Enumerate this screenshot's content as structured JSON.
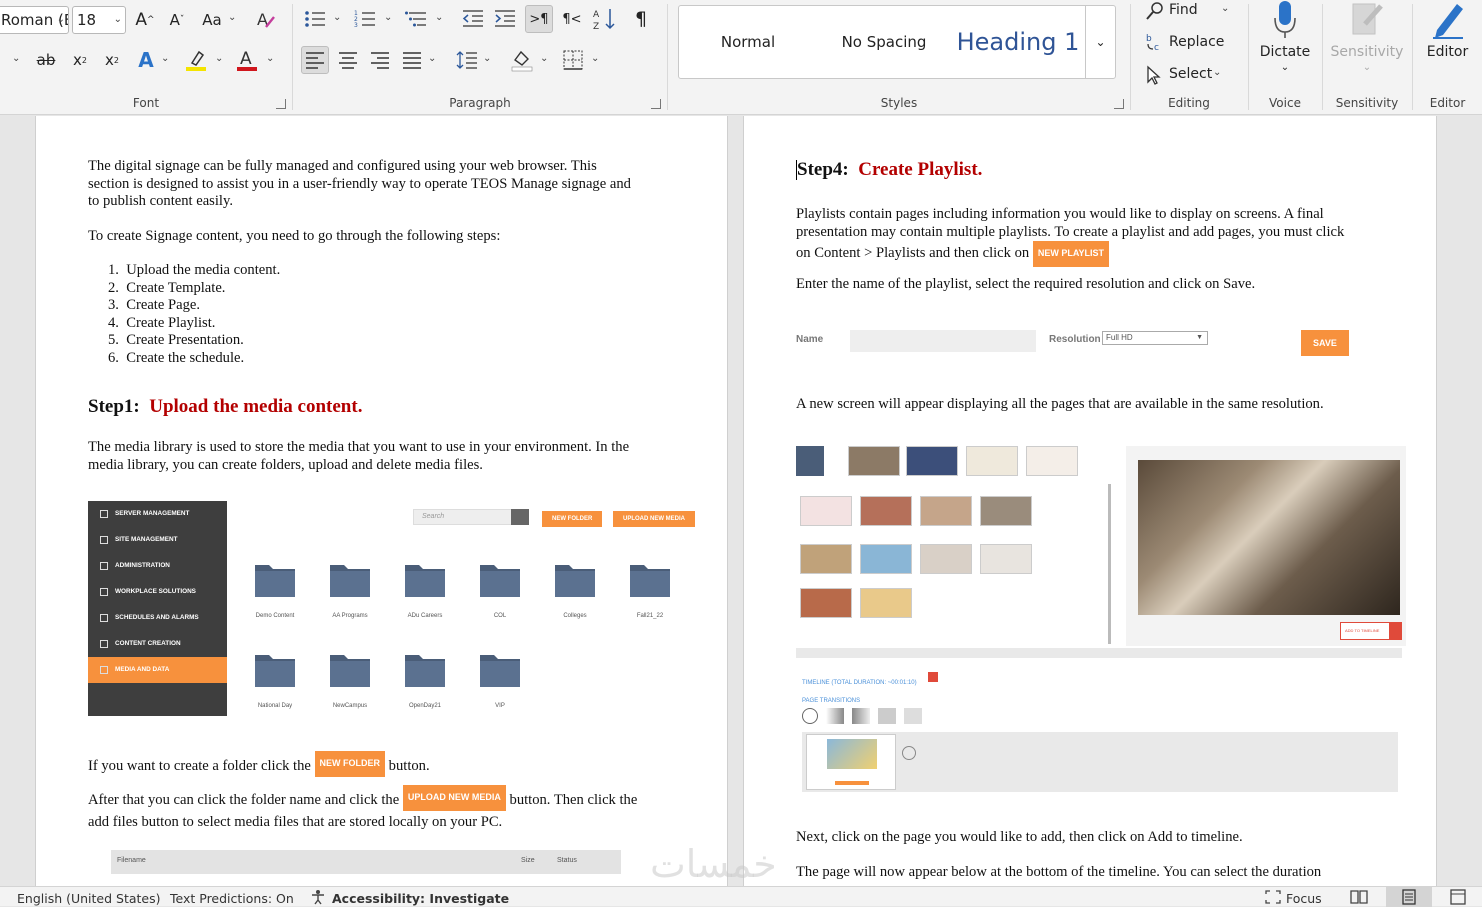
{
  "ribbon": {
    "font_group": {
      "font_name": "Roman (B",
      "font_size": "18",
      "label": "Font",
      "change_case": "Aa"
    },
    "paragraph_group": {
      "label": "Paragraph"
    },
    "styles_group": {
      "label": "Styles",
      "styles": [
        "Normal",
        "No Spacing",
        "Heading 1"
      ]
    },
    "editing_group": {
      "label": "Editing",
      "find": "Find",
      "replace": "Replace",
      "select": "Select"
    },
    "voice_group": {
      "label": "Voice",
      "dictate": "Dictate"
    },
    "sensitivity_group": {
      "label": "Sensitivity",
      "button": "Sensitivity"
    },
    "editor_group": {
      "label": "Editor",
      "button": "Editor"
    },
    "accent_color": "#2b579a"
  },
  "left_page": {
    "intro": "The digital signage can be fully managed and configured using your web browser. This section is designed to assist you in a user-friendly way to operate TEOS Manage signage and to publish content easily.",
    "steps_intro": "To create Signage content, you need to go through the following steps:",
    "steps": [
      "Upload the media content.",
      "Create Template.",
      "Create Page.",
      "Create Playlist.",
      "Create Presentation.",
      "Create the schedule."
    ],
    "step1_prefix": "Step1:",
    "step1_title": "Upload the media content.",
    "media_intro": "The media library is used to store the media that you want to use in your environment. In the media library, you can create folders, upload and delete media files.",
    "screenshot": {
      "menu": [
        "SERVER MANAGEMENT",
        "SITE MANAGEMENT",
        "ADMINISTRATION",
        "WORKPLACE SOLUTIONS",
        "SCHEDULES AND ALARMS",
        "CONTENT CREATION",
        "MEDIA AND DATA"
      ],
      "search_placeholder": "Search",
      "new_folder": "NEW FOLDER",
      "upload": "UPLOAD NEW MEDIA",
      "folders": [
        "Demo Content",
        "AA Programs",
        "ADu Careers",
        "COL",
        "Colleges",
        "Fall21_22",
        "National Day",
        "NewCampus",
        "OpenDay21",
        "VIP"
      ]
    },
    "folder_sentence_a": "If you want to create a folder click the",
    "folder_sentence_b": "button.",
    "new_folder_btn": "NEW FOLDER",
    "upload_sentence_a": "After that you can click the folder name and click the",
    "upload_sentence_b": "button. Then click the add files button to select media files that are stored locally on your PC.",
    "upload_btn": "UPLOAD NEW MEDIA",
    "table_headers": [
      "Filename",
      "Size",
      "Status"
    ]
  },
  "right_page": {
    "step4_prefix": "Step4:",
    "step4_title": "Create Playlist.",
    "playlist_intro": "Playlists contain pages including information you would like to display on screens. A final presentation may contain multiple playlists. To create a playlist and add pages, you must click on Content > Playlists and then click on",
    "new_playlist_btn": "NEW PLAYLIST",
    "enter_name": "Enter the name of the playlist, select the required resolution and click on Save.",
    "form": {
      "name_label": "Name",
      "resolution_label": "Resolution",
      "resolution_value": "Full HD",
      "save": "SAVE"
    },
    "new_screen": "A new screen will appear displaying all the pages that are available in the same resolution.",
    "timeline_label": "TIMELINE (TOTAL DURATION: ~00:01:10)",
    "page_transitions": "PAGE TRANSITIONS",
    "add_to_timeline": "ADD TO TIMELINE",
    "next_click": "Next, click on the page you would like to add, then click on Add to timeline.",
    "will_appear": "The page will now appear below at the bottom of the timeline. You can select the duration"
  },
  "status_bar": {
    "language": "English (United States)",
    "text_predictions": "Text Predictions: On",
    "accessibility": "Accessibility: Investigate",
    "focus": "Focus"
  },
  "watermark": "خمسات"
}
